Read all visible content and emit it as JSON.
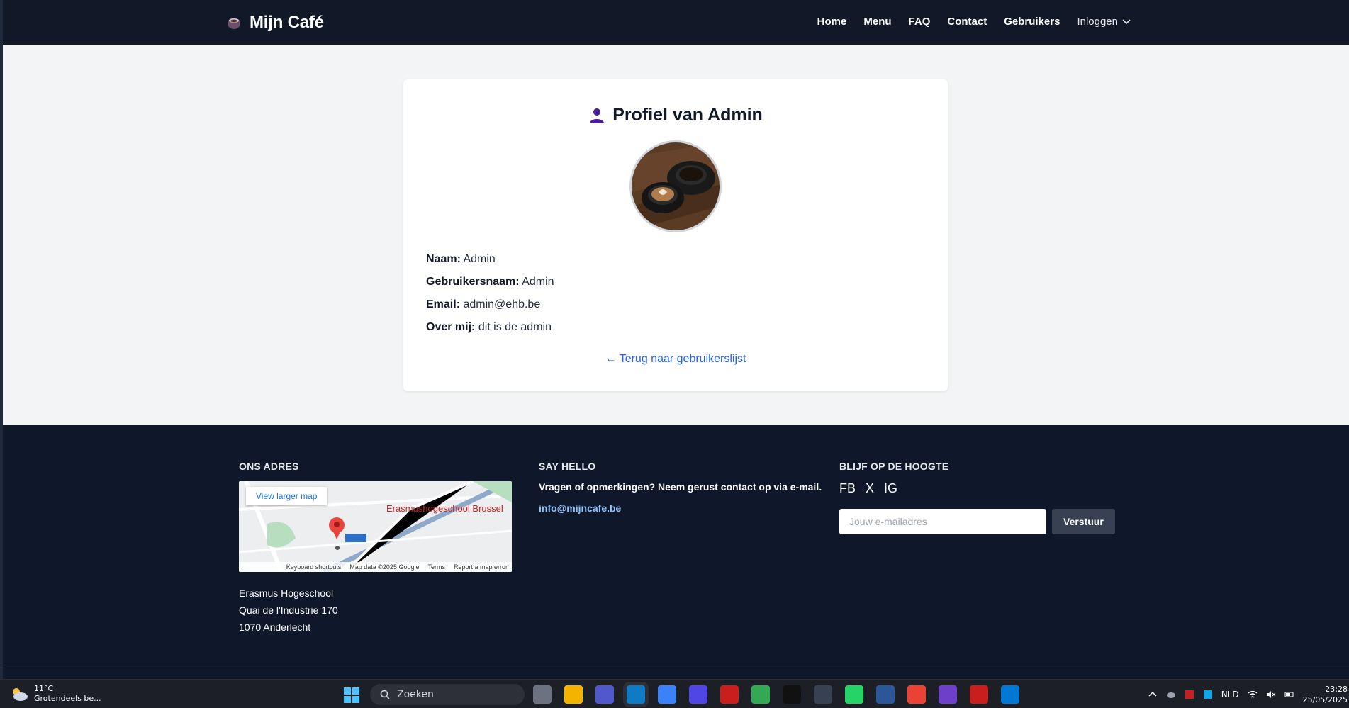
{
  "header": {
    "brand": "Mijn Café",
    "nav": [
      "Home",
      "Menu",
      "FAQ",
      "Contact",
      "Gebruikers"
    ],
    "login": "Inloggen"
  },
  "profile": {
    "title": "Profiel van Admin",
    "fields": [
      {
        "label": "Naam:",
        "value": "Admin"
      },
      {
        "label": "Gebruikersnaam:",
        "value": "Admin"
      },
      {
        "label": "Email:",
        "value": "admin@ehb.be"
      },
      {
        "label": "Over mij:",
        "value": "dit is de admin"
      }
    ],
    "back_link": "← Terug naar gebruikerslijst"
  },
  "footer": {
    "address_heading": "ONS ADRES",
    "map": {
      "view_larger": "View larger map",
      "place": "Erasmushogeschool Brussel",
      "road": "N215",
      "footer_items": [
        "Keyboard shortcuts",
        "Map data ©2025 Google",
        "Terms",
        "Report a map error"
      ]
    },
    "address_lines": [
      "Erasmus Hogeschool",
      "Quai de l'Industrie 170",
      "1070 Anderlecht"
    ],
    "hello_heading": "SAY HELLO",
    "hello_text": "Vragen of opmerkingen? Neem gerust contact op via e-mail.",
    "email": "info@mijncafe.be",
    "follow_heading": "BLIJF OP DE HOOGTE",
    "social": [
      "FB",
      "X",
      "IG"
    ],
    "newsletter_placeholder": "Jouw e-mailadres",
    "newsletter_button": "Verstuur"
  },
  "taskbar": {
    "weather_temp": "11°C",
    "weather_desc": "Grotendeels be...",
    "search": "Zoeken",
    "language": "NLD",
    "time": "23:28",
    "date": "25/05/2025"
  }
}
